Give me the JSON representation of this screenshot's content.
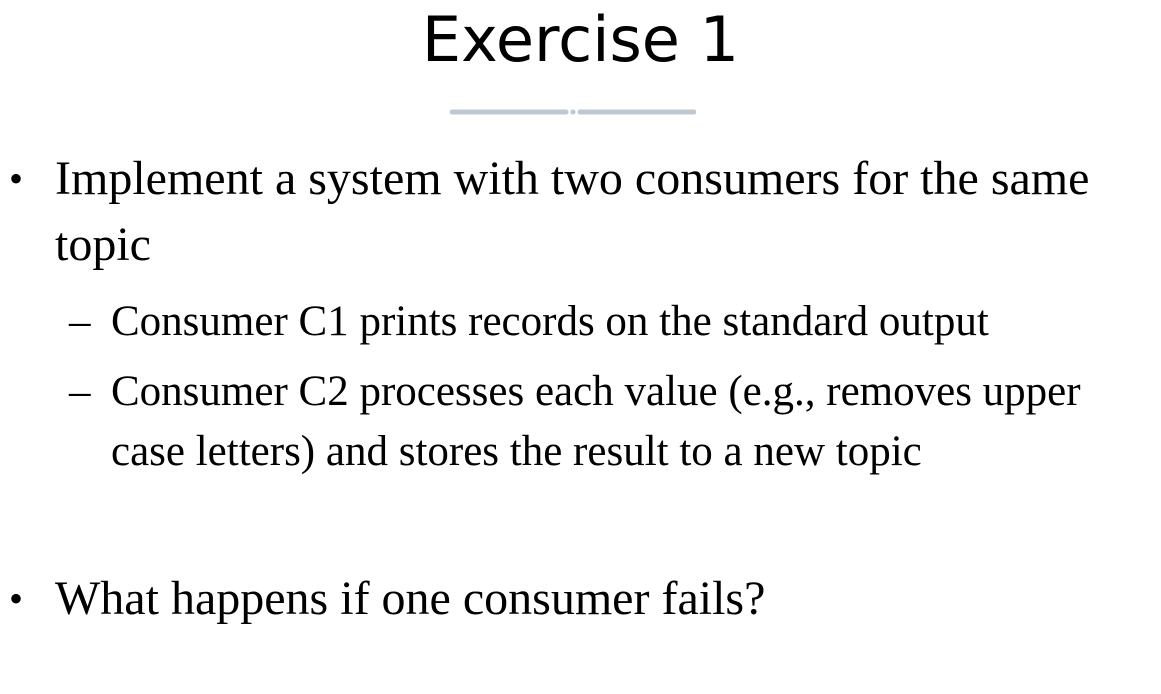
{
  "slide": {
    "title": "Exercise 1",
    "bullets": [
      {
        "marker": "•",
        "text": "Implement a system with two consumers for the same topic"
      },
      {
        "marker": "–",
        "text": "Consumer C1 prints records on the standard output"
      },
      {
        "marker": "–",
        "text": "Consumer C2 processes each value (e.g., removes upper case letters) and stores the result to a new topic"
      },
      {
        "marker": "•",
        "text": "What happens if one consumer fails?"
      }
    ],
    "colors": {
      "text": "#000000",
      "divider": "#bfc8d0",
      "background": "#ffffff"
    }
  }
}
